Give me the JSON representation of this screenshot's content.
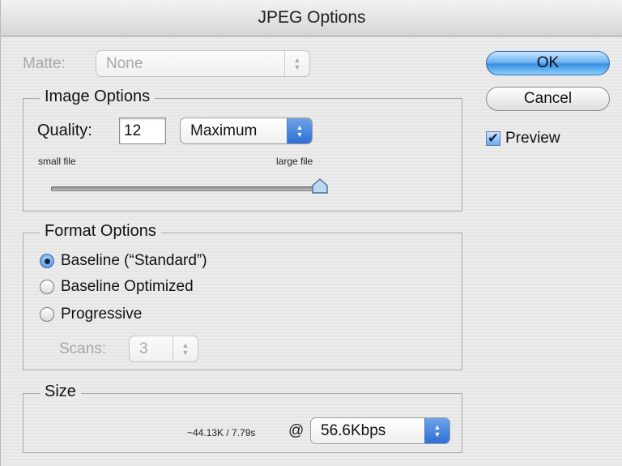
{
  "window": {
    "title": "JPEG Options"
  },
  "matte": {
    "label": "Matte:",
    "value": "None"
  },
  "image_options": {
    "title": "Image Options",
    "quality_label": "Quality:",
    "quality_value": "12",
    "quality_preset": "Maximum",
    "small_file_label": "small file",
    "large_file_label": "large file",
    "slider_level_fraction": 1.0
  },
  "format_options": {
    "title": "Format Options",
    "options": [
      {
        "label": "Baseline (“Standard”)",
        "selected": true
      },
      {
        "label": "Baseline Optimized",
        "selected": false
      },
      {
        "label": "Progressive",
        "selected": false
      }
    ],
    "scans_label": "Scans:",
    "scans_value": "3"
  },
  "size": {
    "title": "Size",
    "estimate": "~44.13K / 7.79s",
    "at_symbol": "@",
    "connection_speed": "56.6Kbps"
  },
  "buttons": {
    "ok": "OK",
    "cancel": "Cancel"
  },
  "preview": {
    "label": "Preview",
    "checked": true,
    "check_glyph": "✔"
  },
  "colors": {
    "default_button": "#3b8fe3",
    "radio_selected": "#3c82dd"
  }
}
